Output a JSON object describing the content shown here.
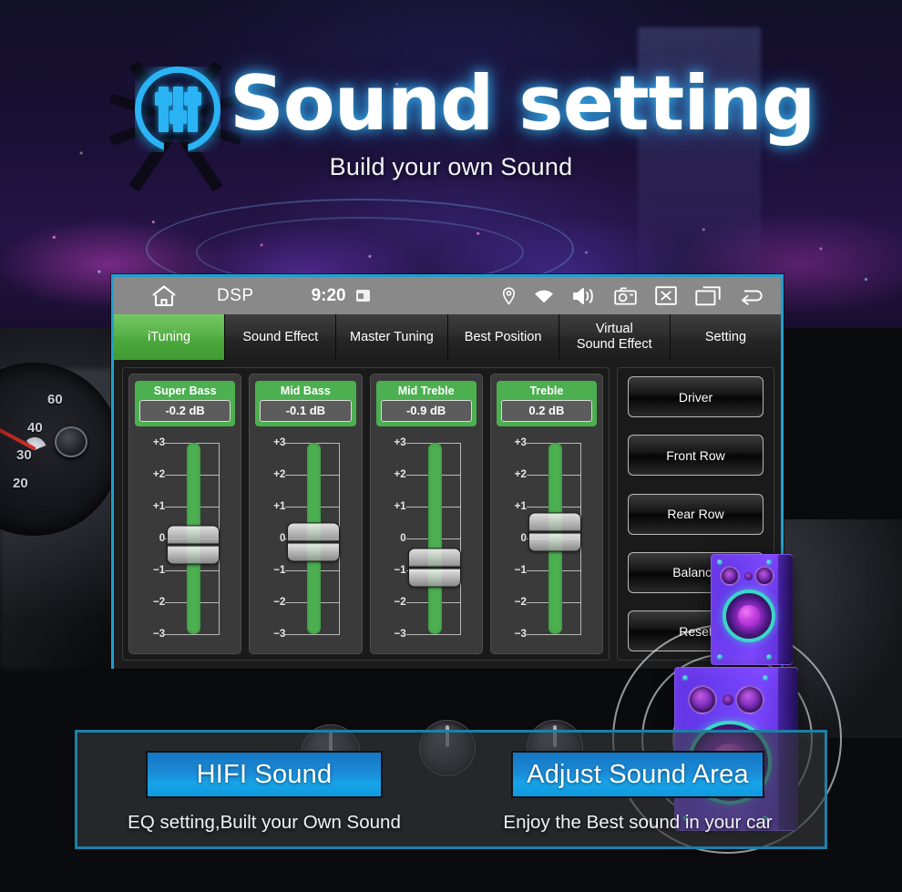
{
  "header": {
    "logo_icon": "equalizer-circle-icon",
    "title": "Sound setting",
    "subtitle": "Build your own Sound"
  },
  "device": {
    "statusbar": {
      "home_icon": "home-icon",
      "app_label": "DSP",
      "time": "9:20",
      "chip_icon": "sd-card-icon",
      "icons": [
        "location-pin-icon",
        "wifi-icon",
        "volume-speaker-icon",
        "camera-icon",
        "close-box-icon",
        "recents-icon",
        "back-arrow-icon"
      ]
    },
    "tabs": [
      {
        "label": "iTuning",
        "active": true
      },
      {
        "label": "Sound Effect",
        "active": false
      },
      {
        "label": "Master Tuning",
        "active": false
      },
      {
        "label": "Best Position",
        "active": false
      },
      {
        "label": "Virtual\nSound Effect",
        "active": false
      },
      {
        "label": "Setting",
        "active": false
      }
    ],
    "tab_labels": {
      "ituning": "iTuning",
      "sound_effect": "Sound Effect",
      "master_tuning": "Master Tuning",
      "best_position": "Best Position",
      "virtual_line1": "Virtual",
      "virtual_line2": "Sound Effect",
      "setting": "Setting"
    },
    "equalizer": {
      "scale_labels": [
        "+3",
        "+2",
        "+1",
        "0",
        "−1",
        "−2",
        "−3"
      ],
      "scale_max": 3,
      "scale_min": -3,
      "bands": [
        {
          "name": "Super Bass",
          "value_text": "-0.2 dB",
          "value": -0.2
        },
        {
          "name": "Mid Bass",
          "value_text": "-0.1 dB",
          "value": -0.1
        },
        {
          "name": "Mid Treble",
          "value_text": "-0.9 dB",
          "value": -0.9
        },
        {
          "name": "Treble",
          "value_text": "0.2 dB",
          "value": 0.2
        }
      ]
    },
    "side_buttons": [
      {
        "label": "Driver"
      },
      {
        "label": "Front Row"
      },
      {
        "label": "Rear Row"
      },
      {
        "label": "Balance"
      },
      {
        "label": "Reset"
      }
    ],
    "colors": {
      "accent_green": "#4caf50",
      "screen_border": "#1e9fd0",
      "statusbar_bg": "#898989",
      "tab_bg": "#2c2c2c"
    }
  },
  "banner": {
    "items": [
      {
        "button": "HIFI Sound",
        "caption": "EQ setting,Built your Own Sound"
      },
      {
        "button": "Adjust Sound Area",
        "caption": "Enjoy the Best sound in your car"
      }
    ],
    "accent": "#17a3e8",
    "border": "#1e7fa8"
  },
  "background": {
    "speedometer_numbers": [
      "60",
      "40",
      "30",
      "20"
    ],
    "speaker_graphic": "stacked-speakers-icon"
  }
}
